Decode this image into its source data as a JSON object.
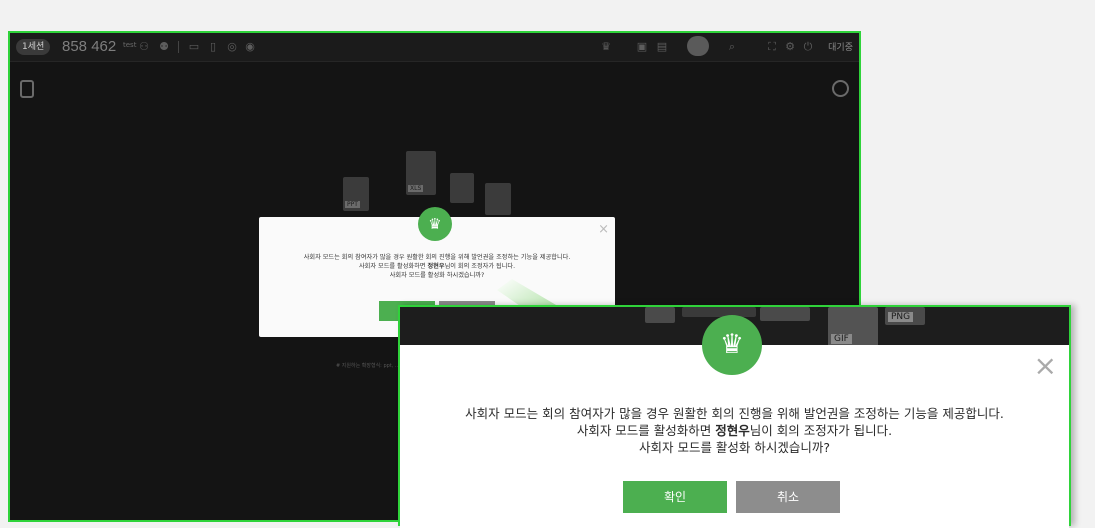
{
  "app": {
    "session_label": "1세션",
    "meeting_id": "858 462",
    "tag": "test",
    "wait_label": "대기중",
    "hint_text": "# 지원하는 확장형식: ppt, ..."
  },
  "small_dialog": {
    "line1": "사회자 모드는 회의 참여자가 많을 경우 원활한 회의 진행을 위해 발언권을 조정하는 기능을 제공합니다.",
    "line2_prefix": "사회자 모드를 활성화하면 ",
    "line2_name": "정현우",
    "line2_suffix": "님이 회의 조정자가 됩니다.",
    "line3": "사회자 모드를 활성화 하시겠습니까?"
  },
  "dialog": {
    "line1": "사회자 모드는 회의 참여자가 많을 경우 원활한 회의 진행을 위해 발언권을 조정하는 기능을 제공합니다.",
    "line2_prefix": "사회자 모드를 활성화하면 ",
    "line2_name": "정현우",
    "line2_suffix": "님이 회의 조정자가 됩니다.",
    "line3": "사회자 모드를 활성화 하시겠습니까?",
    "ok_label": "확인",
    "cancel_label": "취소",
    "close_glyph": "×",
    "crown_icon": "crown-icon"
  },
  "file_types": [
    "PPT",
    "XLS",
    "GIF",
    "PNG"
  ],
  "colors": {
    "accent_green": "#4caf50",
    "highlight_border": "#2fd33a",
    "cancel_gray": "#8d8d8d",
    "dark_bg": "#141414"
  }
}
